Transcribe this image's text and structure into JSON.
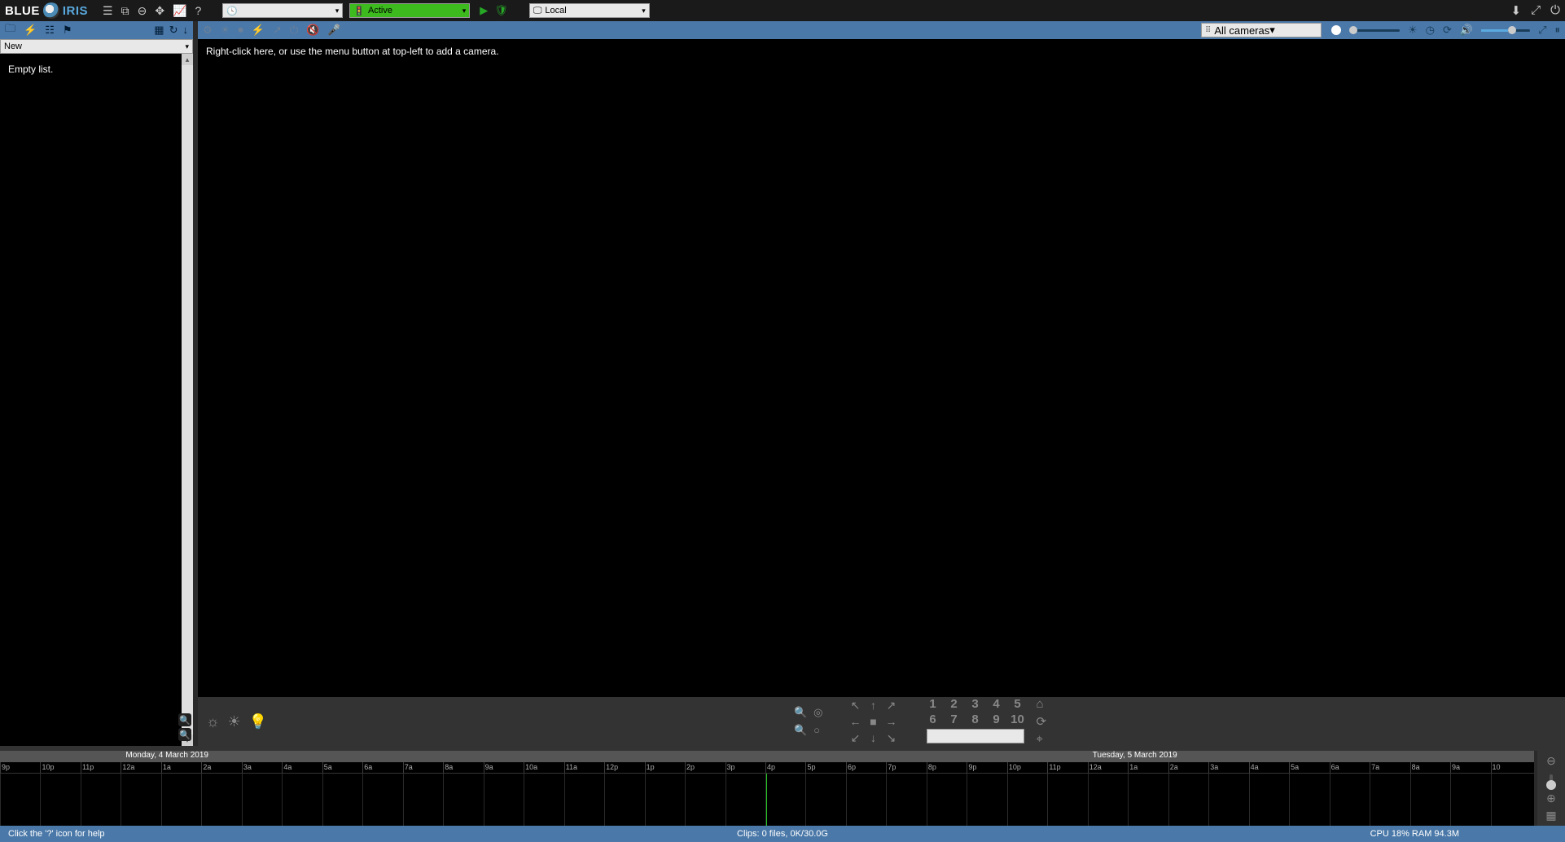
{
  "logo": {
    "part1": "BLUE",
    "part2": "IRIS"
  },
  "titlebar": {
    "schedule_select": "",
    "profile_select": "Active",
    "server_select": "Local"
  },
  "sidebar": {
    "folder_select": "New",
    "empty_msg": "Empty list."
  },
  "viewer": {
    "camera_select": "All cameras",
    "hint": "Right-click here, or use the menu button at top-left to add a camera."
  },
  "ptz": {
    "presets": [
      "1",
      "2",
      "3",
      "4",
      "5",
      "6",
      "7",
      "8",
      "9",
      "10"
    ]
  },
  "timeline": {
    "date1": "Monday, 4 March 2019",
    "date2": "Tuesday, 5 March 2019",
    "hours": [
      "9p",
      "10p",
      "11p",
      "12a",
      "1a",
      "2a",
      "3a",
      "4a",
      "5a",
      "6a",
      "7a",
      "8a",
      "9a",
      "10a",
      "11a",
      "12p",
      "1p",
      "2p",
      "3p",
      "4p",
      "5p",
      "6p",
      "7p",
      "8p",
      "9p",
      "10p",
      "11p",
      "12a",
      "1a",
      "2a",
      "3a",
      "4a",
      "5a",
      "6a",
      "7a",
      "8a",
      "9a",
      "10"
    ],
    "day_boundary_idx": 3,
    "cursor_idx": 19
  },
  "statusbar": {
    "help": "Click the '?' icon for help",
    "clips": "Clips: 0 files, 0K/30.0G",
    "sys": "CPU 18% RAM 94.3M"
  }
}
